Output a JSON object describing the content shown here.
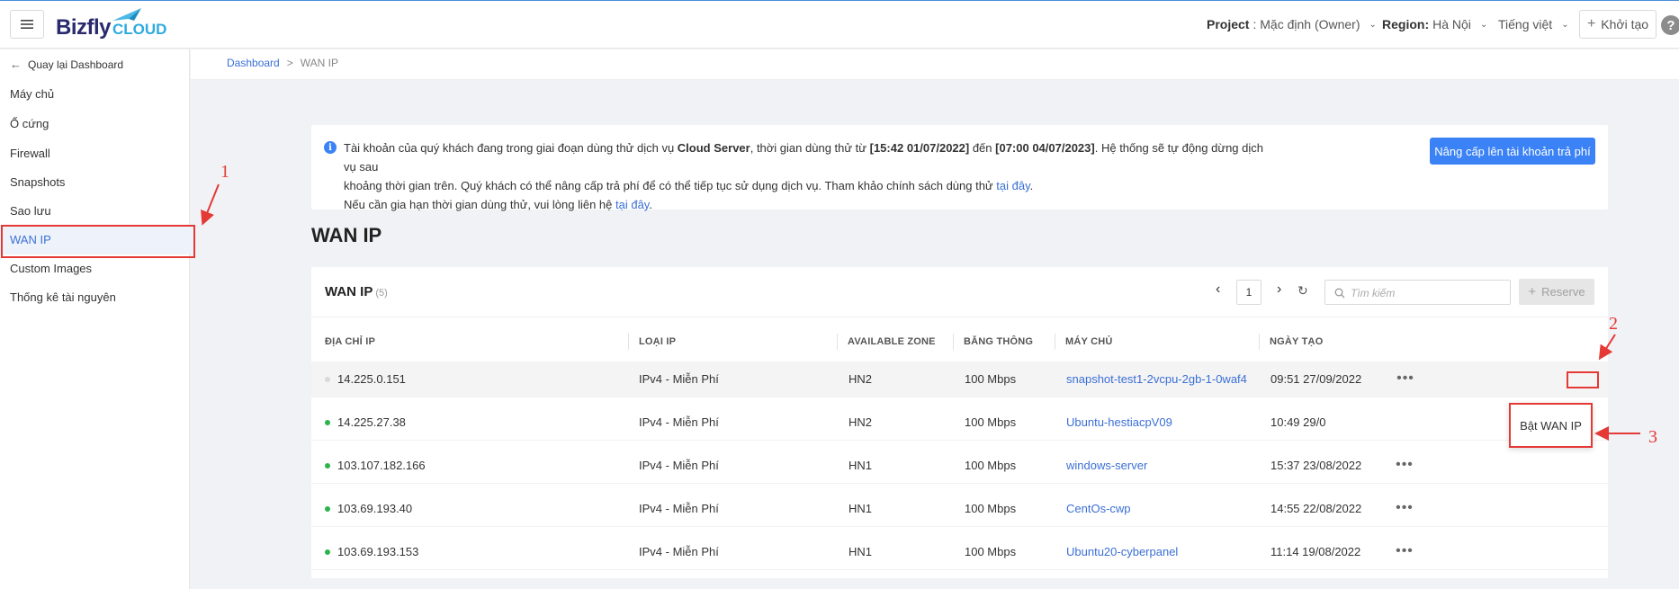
{
  "header": {
    "brand_main": "Bizfly",
    "brand_sub": "CLOUD",
    "project_label": "Project",
    "project_value": ": Mặc định (Owner)",
    "region_label": "Region:",
    "region_value": "Hà Nội",
    "language": "Tiếng việt",
    "create_label": "Khởi tạo",
    "help": "?"
  },
  "sidebar": {
    "back_label": "Quay lại Dashboard",
    "items": [
      {
        "label": "Máy chủ"
      },
      {
        "label": "Ổ cứng"
      },
      {
        "label": "Firewall"
      },
      {
        "label": "Snapshots"
      },
      {
        "label": "Sao lưu"
      },
      {
        "label": "WAN IP",
        "active": true
      },
      {
        "label": "Custom Images"
      },
      {
        "label": "Thống kê tài nguyên"
      }
    ]
  },
  "breadcrumb": {
    "root": "Dashboard",
    "sep": ">",
    "current": "WAN IP"
  },
  "notice": {
    "l1_a": "Tài khoản của quý khách đang trong giai đoạn dùng thử dịch vụ ",
    "l1_b": "Cloud Server",
    "l1_c": ", thời gian dùng thử từ ",
    "l1_d": "[15:42 01/07/2022]",
    "l1_e": " đến ",
    "l1_f": "[07:00 04/07/2023]",
    "l1_g": ". Hệ thống sẽ tự động dừng dịch vụ sau",
    "l2_a": "khoảng thời gian trên. Quý khách có thể nâng cấp trả phí để có thể tiếp tục sử dụng dịch vụ. Tham khảo chính sách dùng thử ",
    "l2_link": "tại đây",
    "l2_end": ".",
    "l3_a": "Nếu cần gia hạn thời gian dùng thử, vui lòng liên hệ ",
    "l3_link": "tại đây",
    "l3_end": ".",
    "upgrade_label": "Nâng cấp lên tài khoản trả phí"
  },
  "page_title": "WAN IP",
  "panel": {
    "title": "WAN IP",
    "count": "(5)",
    "page": "1",
    "search_placeholder": "Tìm kiếm",
    "reserve_label": "Reserve",
    "columns": [
      "ĐỊA CHỈ IP",
      "LOẠI IP",
      "AVAILABLE ZONE",
      "BĂNG THÔNG",
      "MÁY CHỦ",
      "NGÀY TẠO"
    ],
    "rows": [
      {
        "ip": "14.225.0.151",
        "type": "IPv4 - Miễn Phí",
        "zone": "HN2",
        "bandwidth": "100 Mbps",
        "server": "snapshot-test1-2vcpu-2gb-1-0waf4",
        "created": "09:51 27/09/2022",
        "status_color": "#d9d9d9"
      },
      {
        "ip": "14.225.27.38",
        "type": "IPv4 - Miễn Phí",
        "zone": "HN2",
        "bandwidth": "100 Mbps",
        "server": "Ubuntu-hestiacpV09",
        "created": "10:49 29/0",
        "status_color": "#2db34a"
      },
      {
        "ip": "103.107.182.166",
        "type": "IPv4 - Miễn Phí",
        "zone": "HN1",
        "bandwidth": "100 Mbps",
        "server": "windows-server",
        "created": "15:37 23/08/2022",
        "status_color": "#2db34a"
      },
      {
        "ip": "103.69.193.40",
        "type": "IPv4 - Miễn Phí",
        "zone": "HN1",
        "bandwidth": "100 Mbps",
        "server": "CentOs-cwp",
        "created": "14:55 22/08/2022",
        "status_color": "#2db34a"
      },
      {
        "ip": "103.69.193.153",
        "type": "IPv4 - Miễn Phí",
        "zone": "HN1",
        "bandwidth": "100 Mbps",
        "server": "Ubuntu20-cyberpanel",
        "created": "11:14 19/08/2022",
        "status_color": "#2db34a"
      }
    ]
  },
  "dropdown": {
    "item": "Bật WAN IP"
  },
  "annotations": {
    "n1": "1",
    "n2": "2",
    "n3": "3",
    "color": "#e53935"
  }
}
